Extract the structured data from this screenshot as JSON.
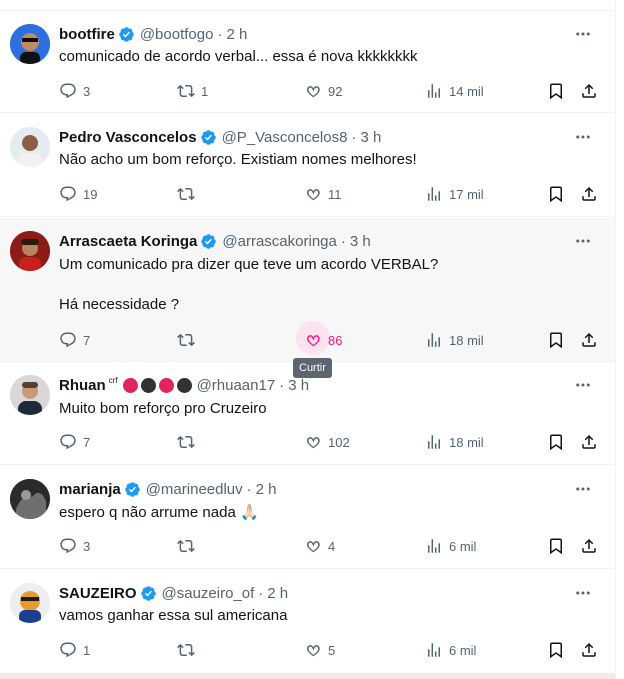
{
  "colors": {
    "accent": "#1d9bf0",
    "like": "#f91880",
    "muted": "#536471",
    "badge_red": "#e0245e",
    "badge_dark": "#2f3336"
  },
  "actions_labels": {
    "like_tooltip": "Curtir"
  },
  "tweets": [
    {
      "name": "bootfire",
      "verified": true,
      "handle": "@bootfogo",
      "time": "2 h",
      "text": "comunicado de acordo verbal... essa é nova kkkkkkkk",
      "replies": "3",
      "reposts": "1",
      "likes": "92",
      "views": "14 mil"
    },
    {
      "name": "Pedro Vasconcelos",
      "verified": true,
      "handle": "@P_Vasconcelos8",
      "time": "3 h",
      "text": "Não acho um bom reforço. Existiam nomes melhores!",
      "replies": "19",
      "reposts": "",
      "likes": "11",
      "views": "17 mil"
    },
    {
      "name": "Arrascaeta Koringa",
      "verified": true,
      "handle": "@arrascakoringa",
      "time": "3 h",
      "text": "Um comunicado pra dizer que teve um acordo VERBAL?\n\nHá necessidade ?",
      "replies": "7",
      "reposts": "",
      "likes": "86",
      "views": "18 mil"
    },
    {
      "name": "Rhuan",
      "name_sup": "crf",
      "verified": false,
      "handle": "@rhuaan17",
      "time": "3 h",
      "text": "Muito bom reforço pro Cruzeiro",
      "replies": "7",
      "reposts": "",
      "likes": "102",
      "views": "18 mil"
    },
    {
      "name": "marianja",
      "verified": true,
      "handle": "@marineedluv",
      "time": "2 h",
      "text": "espero q não arrume nada 🙏🏻",
      "replies": "3",
      "reposts": "",
      "likes": "4",
      "views": "6 mil"
    },
    {
      "name": "SAUZEIRO",
      "verified": true,
      "handle": "@sauzeiro_of",
      "time": "2 h",
      "text": "vamos ganhar essa sul americana",
      "replies": "1",
      "reposts": "",
      "likes": "5",
      "views": "6 mil"
    }
  ],
  "separator": "·"
}
